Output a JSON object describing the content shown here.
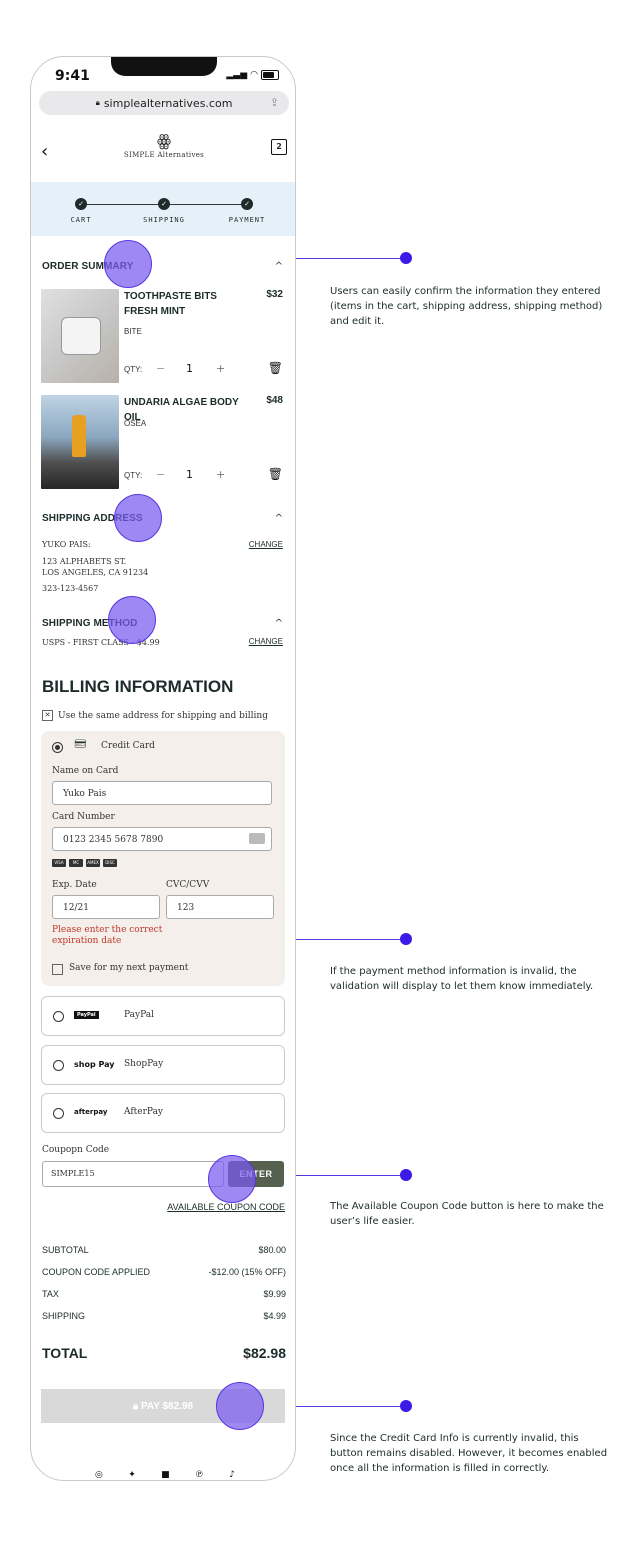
{
  "status": {
    "time": "9:41"
  },
  "browser": {
    "url": "simplealternatives.com"
  },
  "header": {
    "brand": "SIMPLE Alternatives",
    "cart_count": "2"
  },
  "progress": {
    "steps": [
      "CART",
      "SHIPPING",
      "PAYMENT"
    ]
  },
  "order_summary": {
    "title": "ORDER SUMMARY",
    "qty_label": "QTY:",
    "items": [
      {
        "name": "TOOTHPASTE BITS FRESH MINT",
        "price": "$32",
        "brand": "BITE",
        "qty": "1"
      },
      {
        "name": "UNDARIA ALGAE BODY OIL",
        "price": "$48",
        "brand": "OSEA",
        "qty": "1"
      }
    ]
  },
  "shipping_address": {
    "title": "SHIPPING ADDRESS",
    "change": "CHANGE",
    "name": "YUKO PAIS:",
    "line1": "123 ALPHABETS ST.",
    "line2": "LOS ANGELES, CA 91234",
    "phone": "323-123-4567"
  },
  "shipping_method": {
    "title": "SHIPPING METHOD",
    "value": "USPS - FIRST CLASS - $4.99",
    "change": "CHANGE"
  },
  "billing": {
    "title": "BILLING INFORMATION",
    "same_address_label": "Use the same address for shipping and billing",
    "credit_card_label": "Credit Card",
    "name_label": "Name on Card",
    "name_value": "Yuko Pais",
    "number_label": "Card Number",
    "number_value": "0123 2345 5678 7890",
    "card_brands": [
      "VISA",
      "MC",
      "AMEX",
      "DISC"
    ],
    "exp_label": "Exp. Date",
    "exp_value": "12/21",
    "cvc_label": "CVC/CVV",
    "cvc_value": "123",
    "error": "Please enter the correct expiration date",
    "save_label": "Save for my next payment"
  },
  "payment_options": [
    {
      "brand": "PayPal",
      "label": "PayPal"
    },
    {
      "brand": "shop Pay",
      "label": "ShopPay"
    },
    {
      "brand": "afterpay",
      "label": "AfterPay"
    }
  ],
  "coupon": {
    "label": "Coupopn Code",
    "value": "SIMPLE15",
    "button": "ENTER",
    "available": "AVAILABLE COUPON CODE"
  },
  "summary": [
    {
      "label": "SUBTOTAL",
      "value": "$80.00"
    },
    {
      "label": "COUPON CODE APPLIED",
      "value": "-$12.00 (15% OFF)"
    },
    {
      "label": "TAX",
      "value": "$9.99"
    },
    {
      "label": "SHIPPING",
      "value": "$4.99"
    }
  ],
  "total": {
    "label": "TOTAL",
    "value": "$82.98"
  },
  "pay_button": "PAY $82.98",
  "annotations": [
    "Users can easily confirm the information they entered (items in the cart, shipping address, shipping method) and edit it.",
    "If the payment method information is invalid, the validation will display to let them know immediately.",
    "The Available Coupon Code button is here to make the user’s life easier.",
    "Since the Credit Card Info is currently invalid, this button remains disabled. However, it becomes enabled once all the information is filled in correctly."
  ],
  "colors": {
    "accent": "#5636e0",
    "step_bg": "#e6f0f8",
    "panel_bg": "#f4efea",
    "error": "#c0392b",
    "enter_btn": "#56604f"
  }
}
